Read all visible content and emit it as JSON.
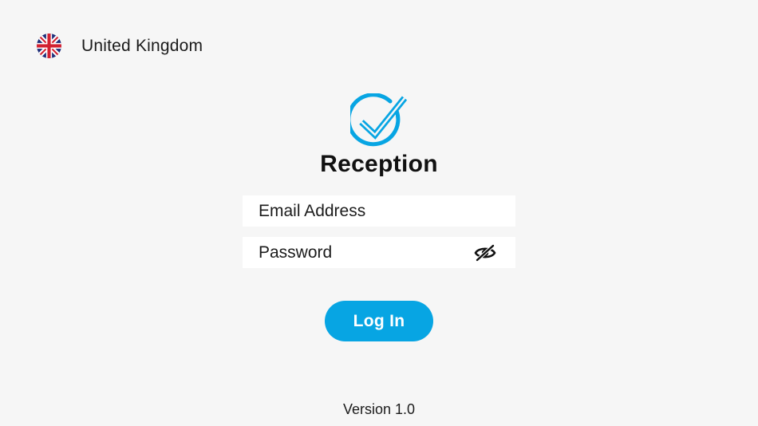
{
  "region": {
    "label": "United Kingdom",
    "flag_icon": "uk-flag-icon"
  },
  "app": {
    "logo_icon": "checkmark-circle-icon",
    "title": "Reception",
    "accent_color": "#07a5e3"
  },
  "form": {
    "email": {
      "placeholder": "Email Address",
      "value": ""
    },
    "password": {
      "placeholder": "Password",
      "value": "",
      "toggle_icon": "eye-slash-icon"
    },
    "login_label": "Log In"
  },
  "footer": {
    "version": "Version 1.0"
  }
}
